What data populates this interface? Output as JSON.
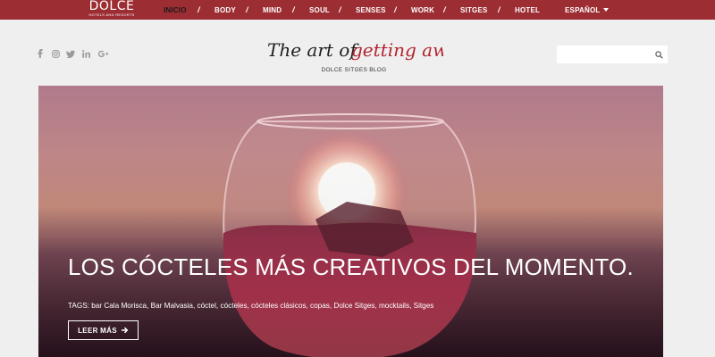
{
  "brand": {
    "logo_main": "DOLCE",
    "logo_sub": "HOTELS AND RESORTS",
    "title_part1": "The art of",
    "title_part2": "getting away",
    "subtitle": "DOLCE SITGES BLOG"
  },
  "nav": {
    "items": [
      {
        "label": "INICIO",
        "active": true
      },
      {
        "label": "BODY"
      },
      {
        "label": "MIND"
      },
      {
        "label": "SOUL"
      },
      {
        "label": "SENSES"
      },
      {
        "label": "WORK"
      },
      {
        "label": "SITGES"
      },
      {
        "label": "HOTEL"
      }
    ],
    "separator": "/",
    "language": "ESPAÑOL"
  },
  "social": [
    "facebook-icon",
    "instagram-icon",
    "twitter-icon",
    "linkedin-icon",
    "google-plus-icon"
  ],
  "search": {
    "placeholder": "",
    "value": ""
  },
  "hero": {
    "title": "LOS CÓCTELES MÁS CREATIVOS DEL MOMENTO.",
    "tags": "TAGS: bar Cala Morisca, Bar Malvasia, cóctel, cócteles, cócteles clásicos, copas, Dolce Sitges, mocktails, Sitges",
    "button_label": "LEER MÁS",
    "button_icon": "arrow-right-icon"
  },
  "colors": {
    "nav_bg": "#9c2d33",
    "accent_red": "#b3232e",
    "page_bg": "#efefef",
    "social_icon": "#9a9a9a"
  }
}
